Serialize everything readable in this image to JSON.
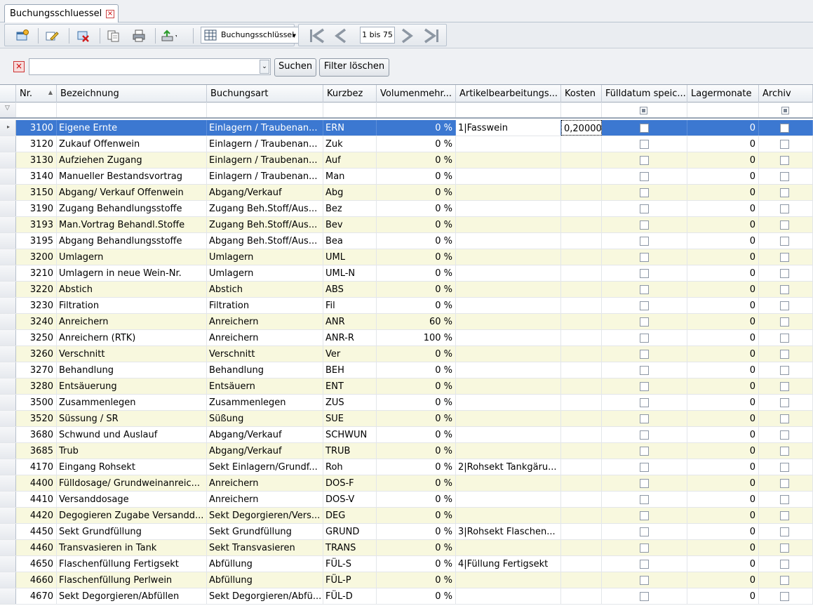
{
  "tab": {
    "title": "Buchungsschluessel",
    "close_glyph": "×"
  },
  "toolbar": {
    "view_dropdown_label": "Buchungsschlüssel",
    "pager_text": "1 bis 75",
    "icons": [
      "new-window-icon",
      "edit-icon",
      "delete-icon",
      "copy-icon",
      "print-icon",
      "export-icon",
      "table-view-icon",
      "first-page-icon",
      "prev-page-icon",
      "next-page-icon",
      "last-page-icon"
    ]
  },
  "filter": {
    "clear_glyph": "×",
    "search_value": "",
    "dropdown_glyph": "⌄",
    "search_button": "Suchen",
    "clear_button": "Filter löschen"
  },
  "grid": {
    "columns": [
      "Nr.",
      "Bezeichnung",
      "Buchungsart",
      "Kurzbez",
      "Volumenmehr...",
      "Artikelbearbeitungs...",
      "Kosten",
      "Fülldatum speic...",
      "Lagermonate",
      "Archiv"
    ],
    "sort_glyph": "▲",
    "filter_glyph": "▽",
    "current_row_glyph": "▸",
    "rows": [
      {
        "nr": "3100",
        "bez": "Eigene Ernte",
        "art": "Einlagern / Traubenan...",
        "kurz": "ERN",
        "vol": "0 %",
        "artikel": "1|Fasswein",
        "kosten": "0,20000",
        "lager": "0"
      },
      {
        "nr": "3120",
        "bez": "Zukauf Offenwein",
        "art": "Einlagern / Traubenan...",
        "kurz": "Zuk",
        "vol": "0 %",
        "artikel": "",
        "kosten": "",
        "lager": "0"
      },
      {
        "nr": "3130",
        "bez": "Aufziehen Zugang",
        "art": "Einlagern / Traubenan...",
        "kurz": "Auf",
        "vol": "0 %",
        "artikel": "",
        "kosten": "",
        "lager": "0"
      },
      {
        "nr": "3140",
        "bez": "Manueller Bestandsvortrag",
        "art": "Einlagern / Traubenan...",
        "kurz": "Man",
        "vol": "0 %",
        "artikel": "",
        "kosten": "",
        "lager": "0"
      },
      {
        "nr": "3150",
        "bez": "Abgang/ Verkauf Offenwein",
        "art": "Abgang/Verkauf",
        "kurz": "Abg",
        "vol": "0 %",
        "artikel": "",
        "kosten": "",
        "lager": "0"
      },
      {
        "nr": "3190",
        "bez": "Zugang Behandlungsstoffe",
        "art": "Zugang Beh.Stoff/Aus...",
        "kurz": "Bez",
        "vol": "0 %",
        "artikel": "",
        "kosten": "",
        "lager": "0"
      },
      {
        "nr": "3193",
        "bez": "Man.Vortrag Behandl.Stoffe",
        "art": "Zugang Beh.Stoff/Aus...",
        "kurz": "Bev",
        "vol": "0 %",
        "artikel": "",
        "kosten": "",
        "lager": "0"
      },
      {
        "nr": "3195",
        "bez": "Abgang Behandlungsstoffe",
        "art": "Abgang Beh.Stoff/Aus...",
        "kurz": "Bea",
        "vol": "0 %",
        "artikel": "",
        "kosten": "",
        "lager": "0"
      },
      {
        "nr": "3200",
        "bez": "Umlagern",
        "art": "Umlagern",
        "kurz": "UML",
        "vol": "0 %",
        "artikel": "",
        "kosten": "",
        "lager": "0"
      },
      {
        "nr": "3210",
        "bez": "Umlagern in neue Wein-Nr.",
        "art": "Umlagern",
        "kurz": "UML-N",
        "vol": "0 %",
        "artikel": "",
        "kosten": "",
        "lager": "0"
      },
      {
        "nr": "3220",
        "bez": "Abstich",
        "art": "Abstich",
        "kurz": "ABS",
        "vol": "0 %",
        "artikel": "",
        "kosten": "",
        "lager": "0"
      },
      {
        "nr": "3230",
        "bez": "Filtration",
        "art": "Filtration",
        "kurz": "Fil",
        "vol": "0 %",
        "artikel": "",
        "kosten": "",
        "lager": "0"
      },
      {
        "nr": "3240",
        "bez": "Anreichern",
        "art": "Anreichern",
        "kurz": "ANR",
        "vol": "60 %",
        "artikel": "",
        "kosten": "",
        "lager": "0"
      },
      {
        "nr": "3250",
        "bez": "Anreichern  (RTK)",
        "art": "Anreichern",
        "kurz": "ANR-R",
        "vol": "100 %",
        "artikel": "",
        "kosten": "",
        "lager": "0"
      },
      {
        "nr": "3260",
        "bez": "Verschnitt",
        "art": "Verschnitt",
        "kurz": "Ver",
        "vol": "0 %",
        "artikel": "",
        "kosten": "",
        "lager": "0"
      },
      {
        "nr": "3270",
        "bez": "Behandlung",
        "art": "Behandlung",
        "kurz": "BEH",
        "vol": "0 %",
        "artikel": "",
        "kosten": "",
        "lager": "0"
      },
      {
        "nr": "3280",
        "bez": "Entsäuerung",
        "art": "Entsäuern",
        "kurz": "ENT",
        "vol": "0 %",
        "artikel": "",
        "kosten": "",
        "lager": "0"
      },
      {
        "nr": "3500",
        "bez": "Zusammenlegen",
        "art": "Zusammenlegen",
        "kurz": "ZUS",
        "vol": "0 %",
        "artikel": "",
        "kosten": "",
        "lager": "0"
      },
      {
        "nr": "3520",
        "bez": "Süssung / SR",
        "art": "Süßung",
        "kurz": "SUE",
        "vol": "0 %",
        "artikel": "",
        "kosten": "",
        "lager": "0"
      },
      {
        "nr": "3680",
        "bez": "Schwund und Auslauf",
        "art": "Abgang/Verkauf",
        "kurz": "SCHWUN",
        "vol": "0 %",
        "artikel": "",
        "kosten": "",
        "lager": "0"
      },
      {
        "nr": "3685",
        "bez": "Trub",
        "art": "Abgang/Verkauf",
        "kurz": "TRUB",
        "vol": "0 %",
        "artikel": "",
        "kosten": "",
        "lager": "0"
      },
      {
        "nr": "4170",
        "bez": "Eingang Rohsekt",
        "art": "Sekt Einlagern/Grundf...",
        "kurz": "Roh",
        "vol": "0 %",
        "artikel": "2|Rohsekt Tankgäru...",
        "kosten": "",
        "lager": "0"
      },
      {
        "nr": "4400",
        "bez": "Fülldosage/ Grundweinanreic...",
        "art": "Anreichern",
        "kurz": "DOS-F",
        "vol": "0 %",
        "artikel": "",
        "kosten": "",
        "lager": "0"
      },
      {
        "nr": "4410",
        "bez": "Versanddosage",
        "art": "Anreichern",
        "kurz": "DOS-V",
        "vol": "0 %",
        "artikel": "",
        "kosten": "",
        "lager": "0"
      },
      {
        "nr": "4420",
        "bez": "Degogieren Zugabe Versandd...",
        "art": "Sekt Degorgieren/Vers...",
        "kurz": "DEG",
        "vol": "0 %",
        "artikel": "",
        "kosten": "",
        "lager": "0"
      },
      {
        "nr": "4450",
        "bez": "Sekt Grundfüllung",
        "art": "Sekt Grundfüllung",
        "kurz": "GRUND",
        "vol": "0 %",
        "artikel": "3|Rohsekt Flaschen...",
        "kosten": "",
        "lager": "0"
      },
      {
        "nr": "4460",
        "bez": "Transvasieren in Tank",
        "art": "Sekt Transvasieren",
        "kurz": "TRANS",
        "vol": "0 %",
        "artikel": "",
        "kosten": "",
        "lager": "0"
      },
      {
        "nr": "4650",
        "bez": "Flaschenfüllung Fertigsekt",
        "art": "Abfüllung",
        "kurz": "FÜL-S",
        "vol": "0 %",
        "artikel": "4|Füllung Fertigsekt",
        "kosten": "",
        "lager": "0"
      },
      {
        "nr": "4660",
        "bez": "Flaschenfüllung Perlwein",
        "art": "Abfüllung",
        "kurz": "FÜL-P",
        "vol": "0 %",
        "artikel": "",
        "kosten": "",
        "lager": "0"
      },
      {
        "nr": "4670",
        "bez": "Sekt Degorgieren/Abfüllen",
        "art": "Sekt Degorgieren/Abfü...",
        "kurz": "FÜL-D",
        "vol": "0 %",
        "artikel": "",
        "kosten": "",
        "lager": "0"
      }
    ]
  },
  "colors": {
    "selection": "#3c78d1",
    "alt_row": "#f8f8de",
    "grid_line": "#e3e6ea"
  }
}
